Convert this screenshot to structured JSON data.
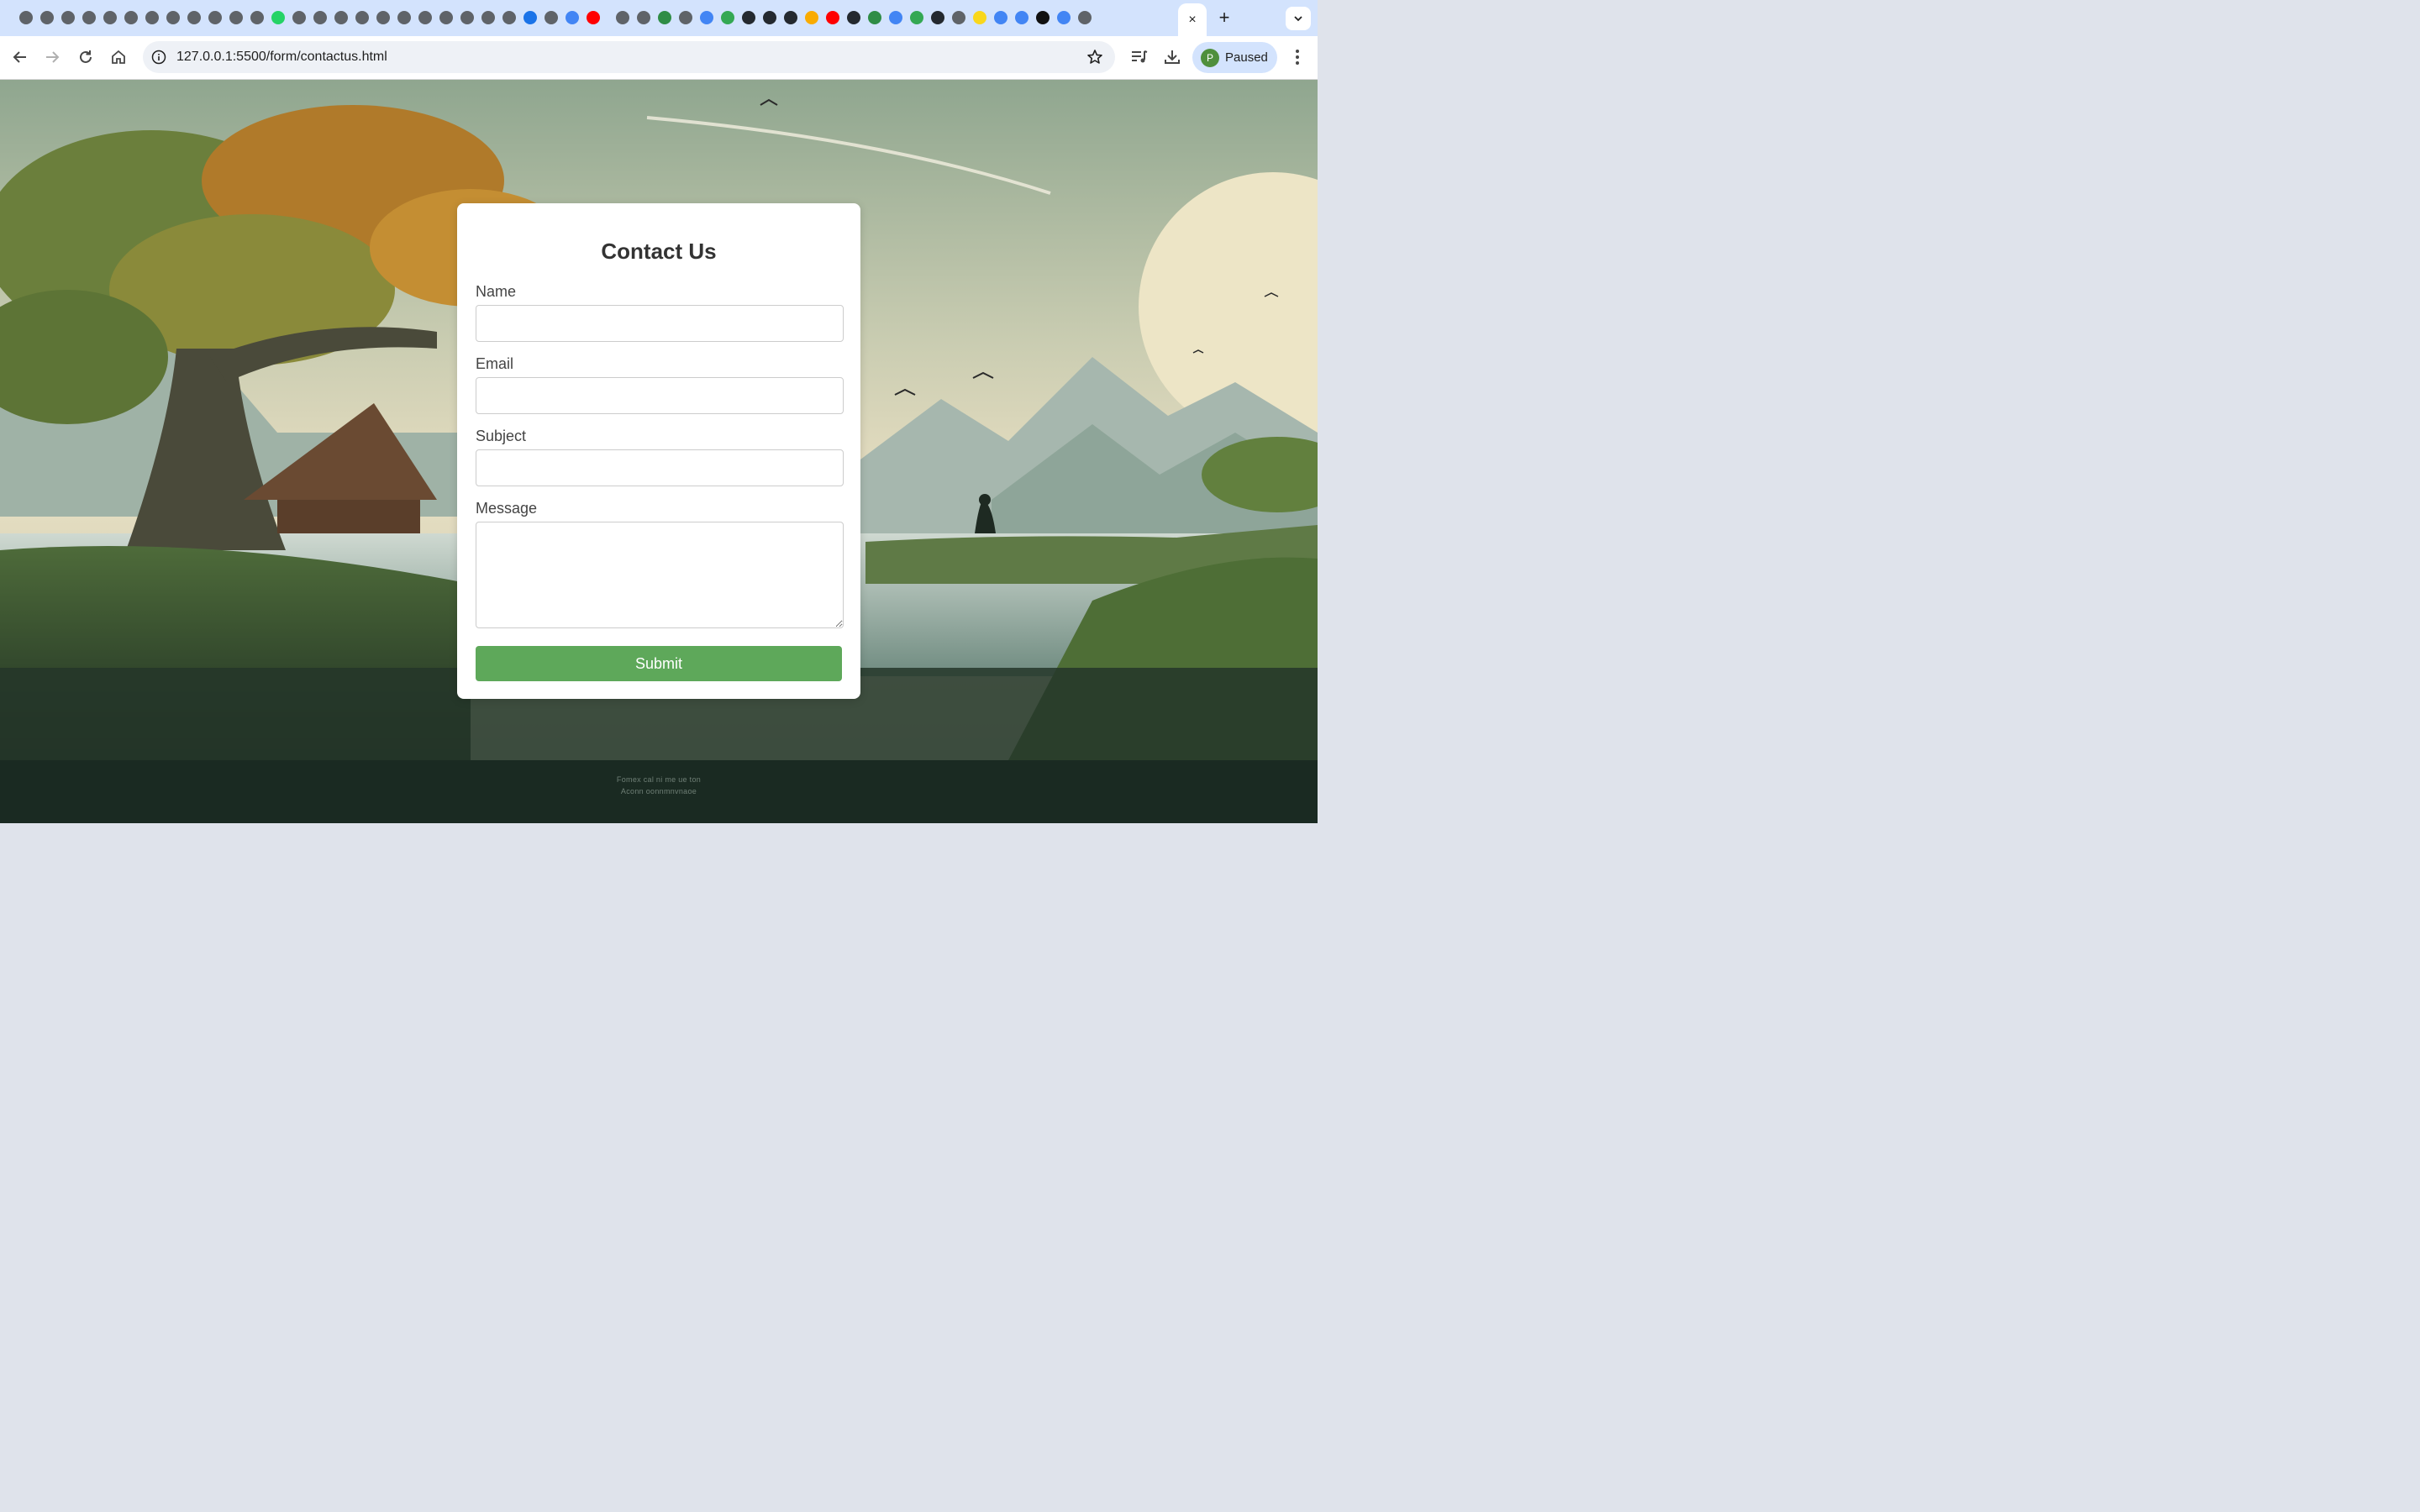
{
  "browser": {
    "tab_colors": [
      "#5f6368",
      "#5f6368",
      "#5f6368",
      "#5f6368",
      "#5f6368",
      "#5f6368",
      "#5f6368",
      "#5f6368",
      "#5f6368",
      "#5f6368",
      "#5f6368",
      "#5f6368",
      "#25d366",
      "#5f6368",
      "#5f6368",
      "#5f6368",
      "#5f6368",
      "#5f6368",
      "#5f6368",
      "#5f6368",
      "#5f6368",
      "#5f6368",
      "#5f6368",
      "#5f6368",
      "#1a73e8",
      "#5f6368",
      "#4285f4",
      "#ff0000",
      "#5f6368",
      "#5f6368",
      "#2f8d46",
      "#5f6368",
      "#4285f4",
      "#34a853",
      "#24292f",
      "#24292f",
      "#24292f",
      "#f9ab00",
      "#ff0000",
      "#24292f",
      "#2f8d46",
      "#4285f4",
      "#34a853",
      "#24292f",
      "#5f6368",
      "#f9d71c",
      "#4285f4",
      "#4285f4",
      "#111111",
      "#4285f4",
      "#5f6368"
    ],
    "active_tab_close": "×",
    "new_tab_label": "+",
    "tab_search_icon": "chevron-down-icon",
    "url": "127.0.0.1:5500/form/contactus.html",
    "profile_initial": "P",
    "profile_status": "Paused",
    "accent": "#d3e3fd"
  },
  "page": {
    "form": {
      "title": "Contact Us",
      "fields": [
        {
          "label": "Name",
          "value": "",
          "placeholder": ""
        },
        {
          "label": "Email",
          "value": "",
          "placeholder": ""
        },
        {
          "label": "Subject",
          "value": "",
          "placeholder": ""
        }
      ],
      "message_label": "Message",
      "message_value": "",
      "submit_label": "Submit",
      "submit_color": "#5ea85a"
    },
    "footer": {
      "line1": "Fomex cal ni me ue ton",
      "line2": "Aconn oonnmnvnaoe"
    }
  }
}
